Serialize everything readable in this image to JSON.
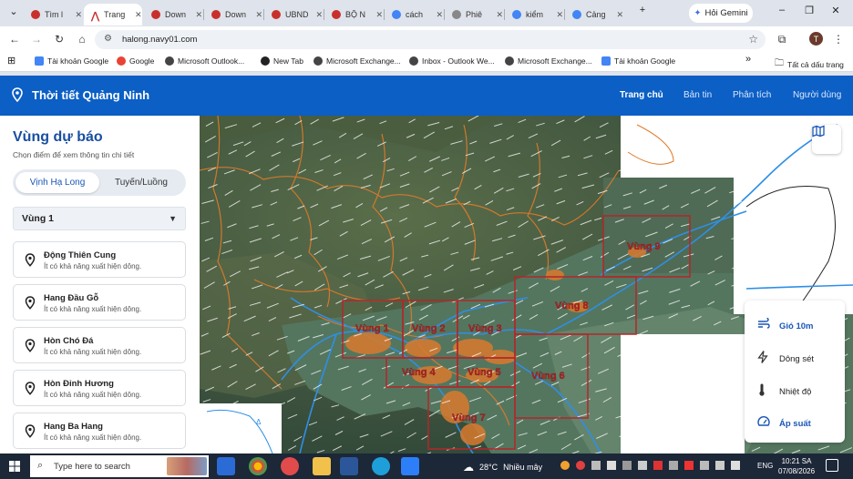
{
  "browser": {
    "tabs": [
      {
        "title": "Tìm l",
        "icon": "ubnd-icon",
        "active": false
      },
      {
        "title": "Trang",
        "icon": "navy-icon",
        "active": true
      },
      {
        "title": "Down",
        "icon": "ubnd-icon",
        "active": false
      },
      {
        "title": "Down",
        "icon": "ubnd-icon",
        "active": false
      },
      {
        "title": "UBND",
        "icon": "ubnd-icon",
        "active": false
      },
      {
        "title": "BỘ N",
        "icon": "ubnd-icon",
        "active": false
      },
      {
        "title": "cách",
        "icon": "google-icon",
        "active": false
      },
      {
        "title": "Phiê",
        "icon": "phien-icon",
        "active": false
      },
      {
        "title": "kiểm",
        "icon": "google-icon",
        "active": false
      },
      {
        "title": "Cảng",
        "icon": "google-icon",
        "active": false
      }
    ],
    "new_tab": "+",
    "gemini_label": "Hỏi Gemini",
    "url": "halong.navy01.com",
    "avatar_letter": "T",
    "bookmarks": [
      {
        "label": "Tài khoản Google",
        "icon": "google-account-icon"
      },
      {
        "label": "Google",
        "icon": "google-icon"
      },
      {
        "label": "Microsoft Outlook...",
        "icon": "outlook-icon"
      },
      {
        "label": "New Tab",
        "icon": "newtab-icon"
      },
      {
        "label": "Microsoft Exchange...",
        "icon": "exchange-icon"
      },
      {
        "label": "Inbox - Outlook We...",
        "icon": "outlook-icon"
      },
      {
        "label": "Microsoft Exchange...",
        "icon": "exchange-icon"
      },
      {
        "label": "Tài khoản Google",
        "icon": "google-account-icon"
      }
    ],
    "bookmarks_more": "»",
    "all_bookmarks": "Tất cả dấu trang"
  },
  "site": {
    "title": "Thời tiết Quảng Ninh",
    "menu": [
      {
        "label": "Trang chủ",
        "active": true
      },
      {
        "label": "Bản tin",
        "active": false
      },
      {
        "label": "Phân tích",
        "active": false
      },
      {
        "label": "Người dùng",
        "active": false
      }
    ]
  },
  "sidebar": {
    "title": "Vùng dự báo",
    "subtitle": "Chọn điểm để xem thông tin chi tiết",
    "tabs": [
      {
        "label": "Vịnh Hạ Long",
        "active": true
      },
      {
        "label": "Tuyến/Luồng",
        "active": false
      }
    ],
    "region_select": "Vùng 1",
    "places": [
      {
        "name": "Động Thiên Cung",
        "desc": "Ít có khả năng xuất hiện dông."
      },
      {
        "name": "Hang Đầu Gỗ",
        "desc": "Ít có khả năng xuất hiện dông."
      },
      {
        "name": "Hòn Chó Đá",
        "desc": "Ít có khả năng xuất hiện dông."
      },
      {
        "name": "Hòn Đỉnh Hương",
        "desc": "Ít có khả năng xuất hiện dông."
      },
      {
        "name": "Hang Ba Hang",
        "desc": "Ít có khả năng xuất hiện dông."
      }
    ]
  },
  "map": {
    "zones": [
      "Vùng 1",
      "Vùng 2",
      "Vùng 3",
      "Vùng 4",
      "Vùng 5",
      "Vùng 6",
      "Vùng 7",
      "Vùng 8",
      "Vùng 9"
    ],
    "inset_label": "Δ",
    "legend": [
      {
        "label": "Gió 10m",
        "icon": "wind-icon",
        "active": true
      },
      {
        "label": "Dông sét",
        "icon": "lightning-icon",
        "active": false
      },
      {
        "label": "Nhiệt độ",
        "icon": "thermometer-icon",
        "active": false
      },
      {
        "label": "Áp suất",
        "icon": "gauge-icon",
        "active": false
      }
    ],
    "colors": {
      "zone_border": "#b3262a",
      "zone_label": "#b3262a",
      "river": "#2f8fe6",
      "boundary": "#e07b2a"
    }
  },
  "taskbar": {
    "search_placeholder": "Type here to search",
    "weather_temp": "28°C",
    "weather_desc": "Nhiều mây",
    "lang": "ENG",
    "time": "10:21 SA",
    "date": "07/08/2026"
  }
}
